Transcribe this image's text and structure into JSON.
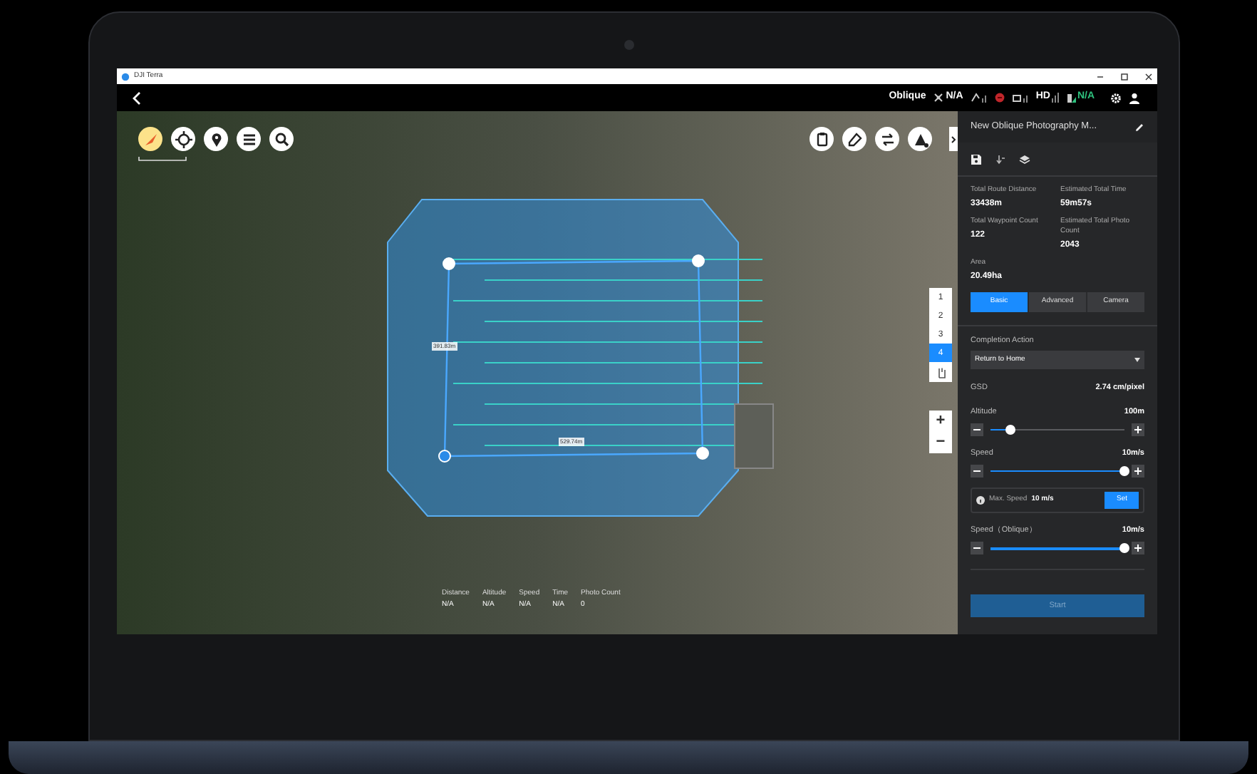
{
  "window": {
    "title": "DJI Terra"
  },
  "top_bar": {
    "mode": "Oblique",
    "gps": "N/A",
    "video_link": "HD",
    "battery": "N/A"
  },
  "map": {
    "edge_labels": [
      "391.83m",
      "529.74m"
    ],
    "tile_buttons": [
      {
        "label": "1",
        "selected": false
      },
      {
        "label": "2",
        "selected": false
      },
      {
        "label": "3",
        "selected": false
      },
      {
        "label": "4",
        "selected": true
      }
    ],
    "zoom_buttons": [
      "+",
      "−"
    ],
    "stats": [
      {
        "label": "Distance",
        "value": "N/A"
      },
      {
        "label": "Altitude",
        "value": "N/A"
      },
      {
        "label": "Speed",
        "value": "N/A"
      },
      {
        "label": "Time",
        "value": "N/A"
      },
      {
        "label": "Photo Count",
        "value": "0"
      }
    ]
  },
  "panel": {
    "mission_name": "New Oblique Photography M...",
    "summary": [
      {
        "label": "Total Route Distance",
        "value": "33438m"
      },
      {
        "label": "Estimated Total Time",
        "value": "59m57s"
      },
      {
        "label": "Total Waypoint Count",
        "value": "122"
      },
      {
        "label": "Estimated Total Photo Count",
        "value": "2043"
      },
      {
        "label": "Area",
        "value": "20.49ha"
      }
    ],
    "tabs": [
      {
        "label": "Basic",
        "selected": true
      },
      {
        "label": "Advanced",
        "selected": false
      },
      {
        "label": "Camera",
        "selected": false
      }
    ],
    "completion_action": {
      "label": "Completion Action",
      "value": "Return to Home"
    },
    "gsd": {
      "label": "GSD",
      "value": "2.74 cm/pixel"
    },
    "sliders": [
      {
        "label": "Altitude",
        "reading": "100m",
        "level": 0.15
      },
      {
        "label": "Speed",
        "reading": "10m/s",
        "level": 1.0
      },
      {
        "label": "Speed（Oblique）",
        "reading": "10m/s",
        "level": 1.0
      }
    ],
    "max_speed": {
      "label": "Max. Speed",
      "value": "10 m/s",
      "button": "Set"
    },
    "start_button": {
      "label": "Start",
      "disabled": true
    }
  }
}
